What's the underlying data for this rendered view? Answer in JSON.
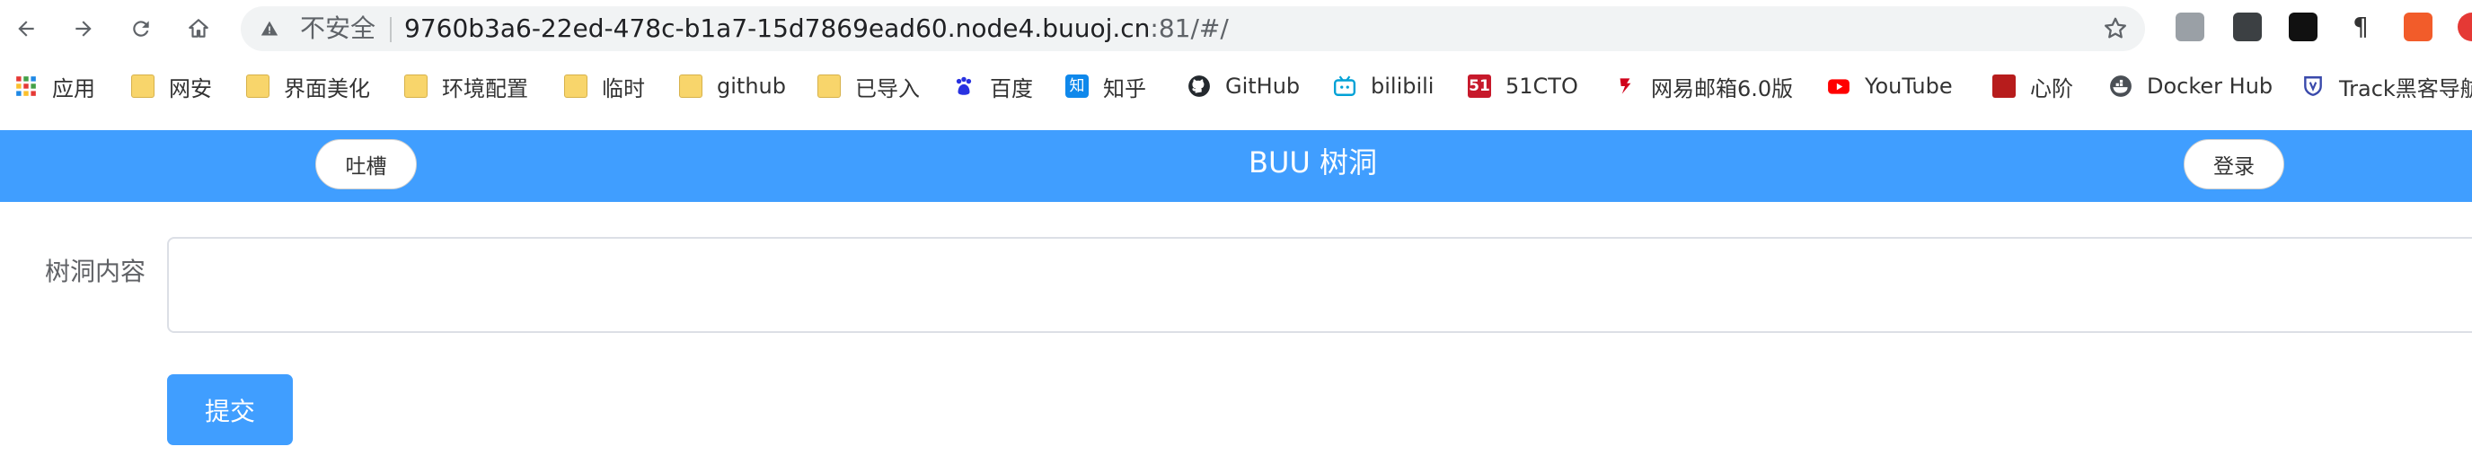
{
  "browser": {
    "security_label": "不安全",
    "url_host": "9760b3a6-22ed-478c-b1a7-15d7869ead60.node4.buuoj.cn",
    "url_path": ":81/#/"
  },
  "bookmarks": {
    "items": [
      {
        "label": "应用",
        "icon": "apps-grid-icon"
      },
      {
        "label": "网安",
        "icon": "folder-icon"
      },
      {
        "label": "界面美化",
        "icon": "folder-icon"
      },
      {
        "label": "环境配置",
        "icon": "folder-icon"
      },
      {
        "label": "临时",
        "icon": "folder-icon"
      },
      {
        "label": "github",
        "icon": "folder-icon"
      },
      {
        "label": "已导入",
        "icon": "folder-icon"
      },
      {
        "label": "百度",
        "icon": "baidu-icon"
      },
      {
        "label": "知乎",
        "icon": "zhihu-icon"
      },
      {
        "label": "GitHub",
        "icon": "github-icon"
      },
      {
        "label": "bilibili",
        "icon": "bilibili-icon"
      },
      {
        "label": "51CTO",
        "icon": "51cto-icon"
      },
      {
        "label": "网易邮箱6.0版",
        "icon": "netease-mail-icon"
      },
      {
        "label": "YouTube",
        "icon": "youtube-icon"
      },
      {
        "label": "心阶",
        "icon": "xinjie-icon"
      },
      {
        "label": "Docker Hub",
        "icon": "docker-icon"
      },
      {
        "label": "Track黑客导航",
        "icon": "track-icon"
      }
    ]
  },
  "banner": {
    "left_button": "吐槽",
    "title": "BUU 树洞",
    "right_button": "登录"
  },
  "form": {
    "label": "树洞内容",
    "content_value": "",
    "submit_label": "提交"
  },
  "colors": {
    "accent": "#409eff",
    "toolbar_bg": "#ffffff",
    "omnibox_bg": "#f1f3f4"
  }
}
